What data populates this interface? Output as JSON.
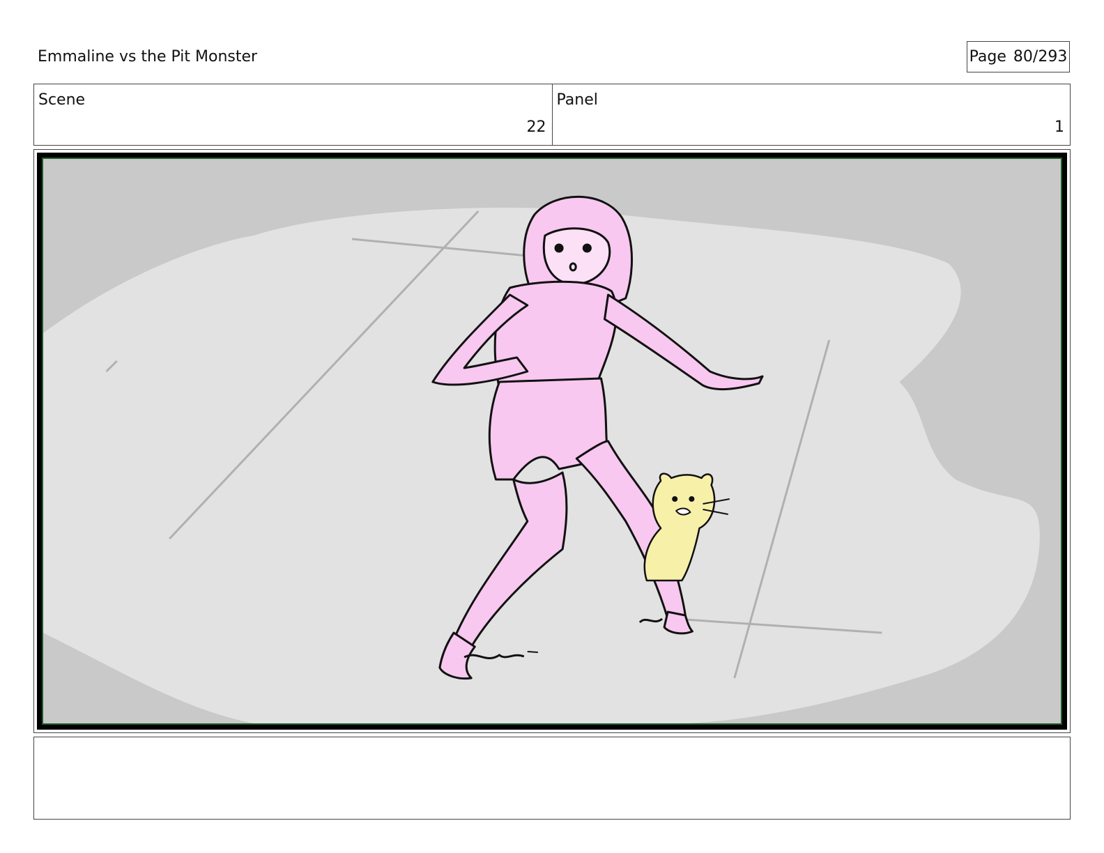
{
  "header": {
    "title": "Emmaline vs the Pit Monster",
    "page_label": "Page",
    "page_value": "80/293"
  },
  "info": {
    "scene_label": "Scene",
    "scene_value": "22",
    "panel_label": "Panel",
    "panel_value": "1"
  },
  "notes": {
    "text": ""
  },
  "colors": {
    "frame_border": "#1e5a2a",
    "floor_dark": "#c9c9c9",
    "floor_light": "#e2e2e2",
    "character_pink": "#f8c8f0",
    "creature_yellow": "#f7f0a8"
  }
}
